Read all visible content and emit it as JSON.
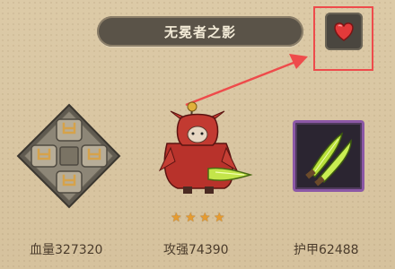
{
  "hero": {
    "name": "无冕者之影",
    "star_count": 4,
    "star_glyph": "★"
  },
  "stats": {
    "hp_label": "血量327320",
    "attack_label": "攻强74390",
    "armor_label": "护甲62488"
  },
  "icons": {
    "favorite": "heart-icon",
    "skill": "dpad-skill-icon",
    "weapon": "twin-blades-icon"
  },
  "colors": {
    "heart": "#e33a3a",
    "highlight": "#ee4b4b",
    "weapon_frame": "#8c58a6",
    "star": "#e69b2f"
  }
}
